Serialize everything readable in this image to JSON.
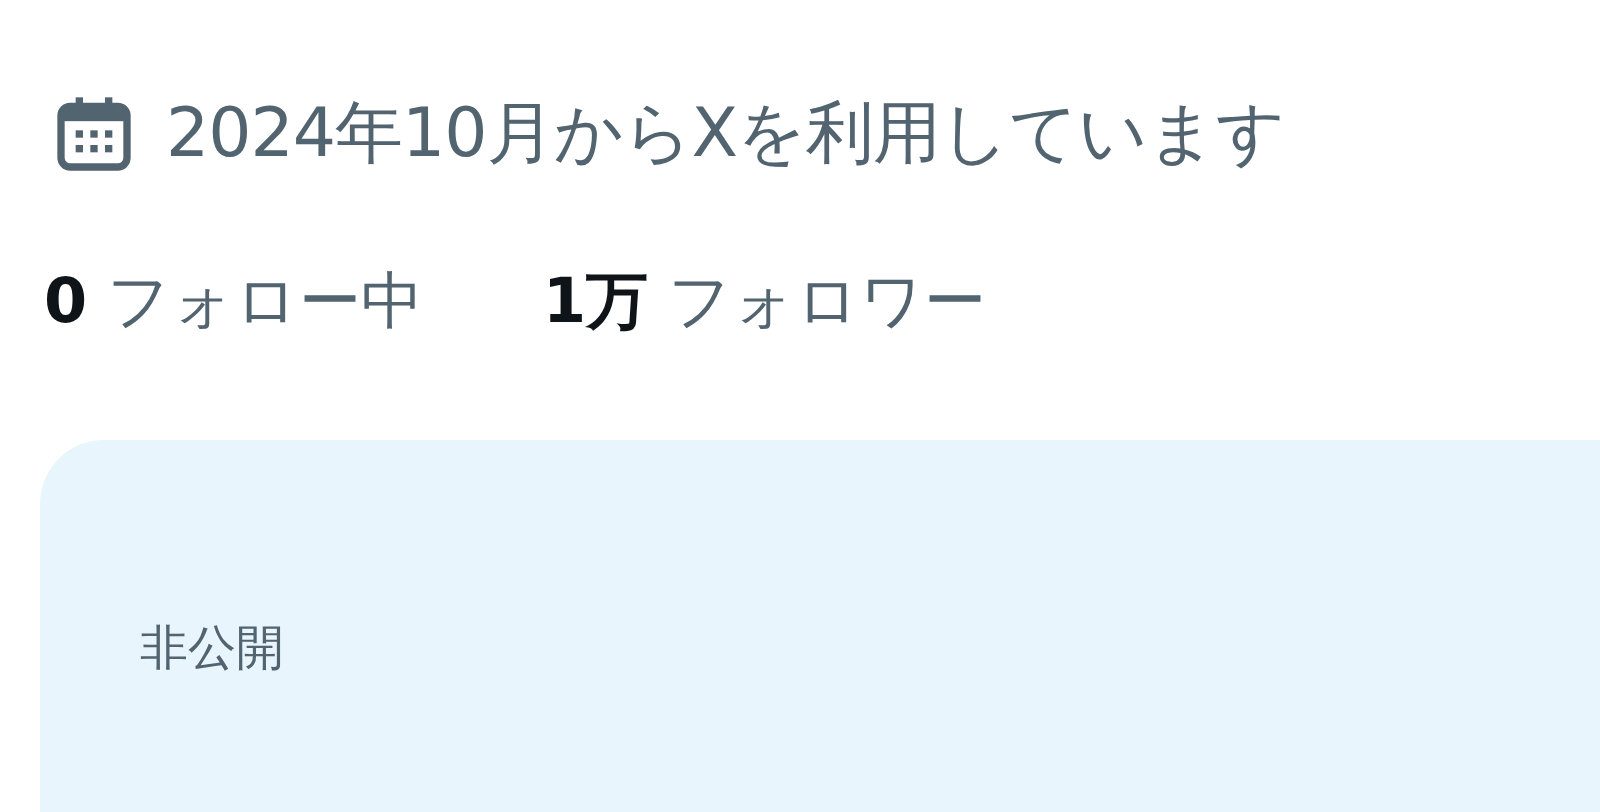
{
  "joined": "2024年10月からXを利用しています",
  "stats": [
    {
      "count": "0",
      "label": "フォロー中"
    },
    {
      "count": "1万",
      "label": "フォロワー"
    }
  ],
  "card": {
    "label": "非公開"
  }
}
